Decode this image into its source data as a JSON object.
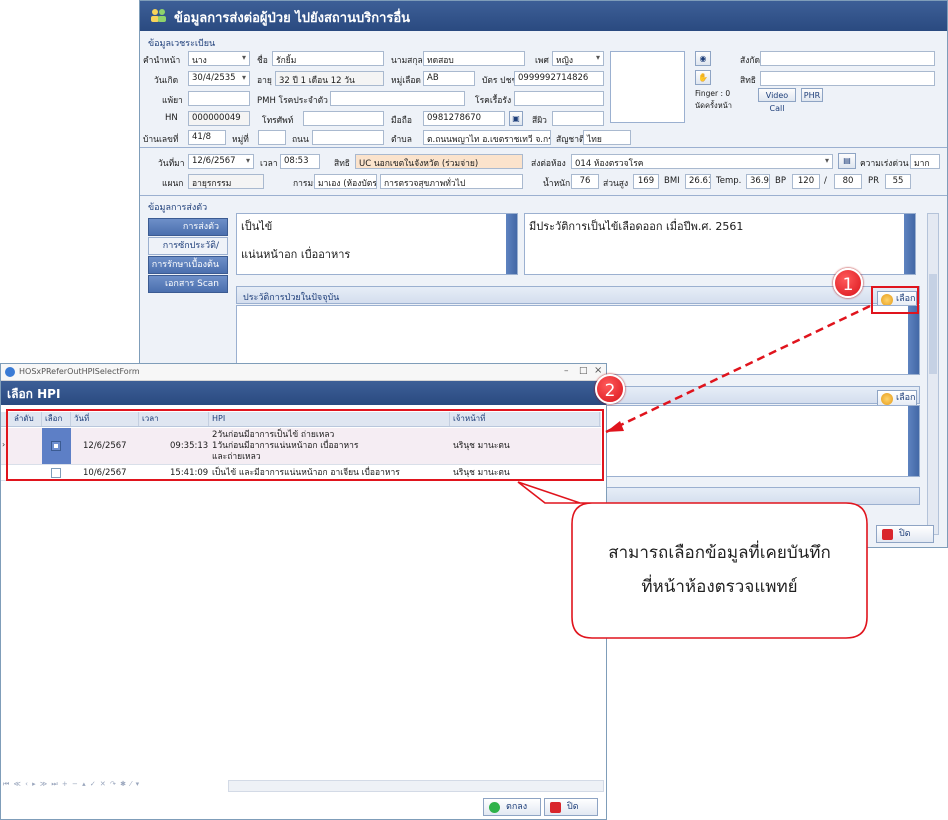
{
  "main": {
    "title": "ข้อมูลการส่งต่อผู้ป่วย ไปยังสถานบริการอื่น",
    "reg_section": "ข้อมูลเวชระเบียน",
    "labels": {
      "prefix": "คำนำหน้า",
      "name": "ชื่อ",
      "surname": "นามสกุล",
      "sex": "เพศ",
      "affiliation": "สังกัด",
      "birthdate": "วันเกิด",
      "age": "อายุ",
      "bloodgroup": "หมู่เลือด",
      "cid": "บัตร ปชช.",
      "rights": "สิทธิ",
      "allergy": "แพ้ยา",
      "pmh": "PMH โรคประจำตัว",
      "underlying": "โรคเรื้อรัง",
      "hn": "HN",
      "phone": "โทรศัพท์",
      "mobile": "มือถือ",
      "skin": "สีผิว",
      "address": "บ้านเลขที่",
      "moo": "หมู่ที่",
      "road": "ถนน",
      "tambon": "ตำบล",
      "nationality": "สัญชาติ",
      "finger": "Finger : 0",
      "appointment": "นัดครั้งหน้า"
    },
    "values": {
      "prefix": "นาง",
      "name": "รักยิ้ม",
      "surname": "ทดสอบ",
      "sex": "หญิง",
      "birthdate": "30/4/2535",
      "age": "32 ปี 1 เดือน 12 วัน",
      "bloodgroup": "AB",
      "cid": "0999992714826",
      "hn": "000000049",
      "mobile": "0981278670",
      "address": "41/8",
      "tambon": "ต.ถนนพญาไท อ.เขตราชเทวี จ.กรุงเทพมหานคร",
      "nationality": "ไทย"
    },
    "buttons": {
      "video_call": "Video Call",
      "phr": "PHR"
    },
    "visit": {
      "date_label": "วันที่มา",
      "date": "12/6/2567",
      "time_label": "เวลา",
      "time": "08:53",
      "rights_label": "สิทธิ",
      "rights": "UC นอกเขตในจังหวัด (ร่วมจ่าย)",
      "room_label": "ส่งต่อห้อง",
      "room": "014 ห้องตรวจโรค",
      "urgency_label": "ความเร่งด่วน",
      "urgency": "มาก",
      "dept_label": "แผนก",
      "dept": "อายุรกรรม",
      "type_label": "การมา",
      "type": "มาเอง (ห้องบัตร)",
      "service": "การตรวจสุขภาพทั่วไป",
      "weight_label": "น้ำหนัก",
      "weight": "76",
      "height_label": "ส่วนสูง",
      "height": "169",
      "bmi_label": "BMI",
      "bmi": "26.61",
      "temp_label": "Temp.",
      "temp": "36.9",
      "bp_label": "BP",
      "bp_sys": "120",
      "bp_slash": "/",
      "bp_dia": "80",
      "pr_label": "PR",
      "pr": "55"
    },
    "refer_section": "ข้อมูลการส่งตัว",
    "side_tabs": [
      "การส่งตัว",
      "การซักประวัติ/รักษา",
      "การรักษาเบื้องต้น",
      "เอกสาร Scan"
    ],
    "cc_text": "เป็นไข้",
    "cc_text2": "แน่นหน้าอก เบื่ออาหาร",
    "history_text": "มีประวัติการเป็นไข้เลือดออก เมื่อปีพ.ศ. 2561",
    "hpi_group": "ประวัติการป่วยในปัจจุบัน",
    "select_label": "เลือก",
    "select_label2": "เลือก",
    "close_label": "ปิด"
  },
  "popup": {
    "window_title": "HOSxPReferOutHPISelectForm",
    "header": "เลือก HPI",
    "columns": [
      "ลำดับ",
      "เลือก",
      "วันที่",
      "เวลา",
      "HPI",
      "เจ้าหน้าที่"
    ],
    "rows": [
      {
        "checked": true,
        "date": "12/6/2567",
        "time": "09:35:13",
        "hpi": [
          "2วันก่อนมีอาการเป็นไข้ ถ่ายเหลว",
          "1วันก่อนมีอาการแน่นหน้าอก เบื่ออาหาร",
          "และถ่ายเหลว"
        ],
        "staff": "นรินุช มานะตน"
      },
      {
        "checked": false,
        "date": "10/6/2567",
        "time": "15:41:09",
        "hpi": [
          "เป็นไข้ และมีอาการแน่นหน้าอก อาเจียน เบื่ออาหาร"
        ],
        "staff": "นรินุช มานะตน"
      }
    ],
    "ok_label": "ตกลง",
    "close_label": "ปิด"
  },
  "annotations": {
    "badge1": "1",
    "badge2": "2",
    "callout_line1": "สามารถเลือกข้อมูลที่เคยบันทึก",
    "callout_line2": "ที่หน้าห้องตรวจแพทย์",
    "accent": "#e0141d"
  }
}
